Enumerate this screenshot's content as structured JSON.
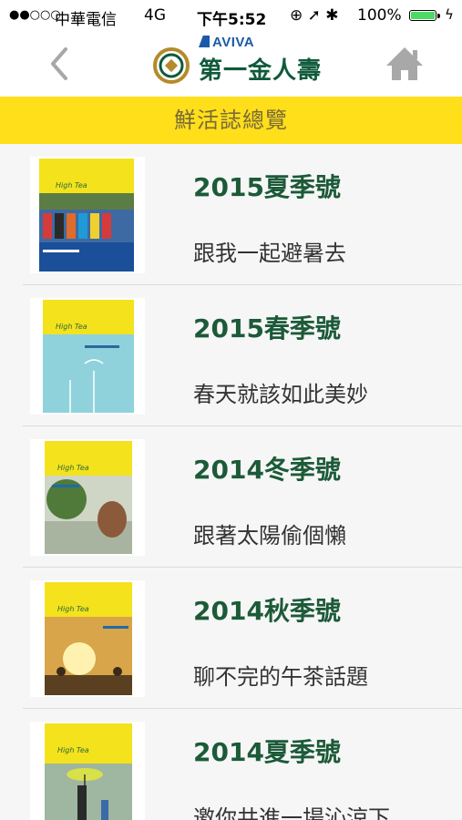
{
  "status_bar": {
    "signal": "●●○○○",
    "carrier": "中華電信",
    "network": "4G",
    "time": "下午5:52",
    "icons": "⊕ ➚ ✱",
    "battery_percent": "100%",
    "battery_level": 1.0,
    "charging_icon": "ϟ"
  },
  "nav": {
    "back_icon": "chevron-left-icon",
    "home_icon": "home-icon",
    "logo_brand": "AVIVA",
    "logo_name": "第一金人壽"
  },
  "page_title": "鮮活誌總覽",
  "colors": {
    "title_bar_bg": "#fedf1a",
    "title_text": "#7a6a3a",
    "issue_title": "#1c5a38",
    "brand_green": "#0f5a3a",
    "aviva_blue": "#1b5aa6"
  },
  "issues": [
    {
      "title": "2015夏季號",
      "subtitle": "跟我一起避暑去",
      "cover_masthead": "High Tea 鮮活誌",
      "cover_scene": "colorful-beach-huts"
    },
    {
      "title": "2015春季號",
      "subtitle": "春天就該如此美妙",
      "cover_masthead": "High Tea 鮮活誌",
      "cover_scene": "blue-sky-windmills"
    },
    {
      "title": "2014冬季號",
      "subtitle": "跟著太陽偷個懶",
      "cover_masthead": "High Tea 鮮活誌",
      "cover_scene": "woman-under-tree"
    },
    {
      "title": "2014秋季號",
      "subtitle": "聊不完的午茶話題",
      "cover_masthead": "High Tea 鮮活誌",
      "cover_scene": "sunset-silhouettes"
    },
    {
      "title": "2014夏季號",
      "subtitle": "邀你共進一場沁涼下",
      "cover_masthead": "High Tea 鮮活誌",
      "cover_scene": "umbrella-in-rain"
    }
  ]
}
